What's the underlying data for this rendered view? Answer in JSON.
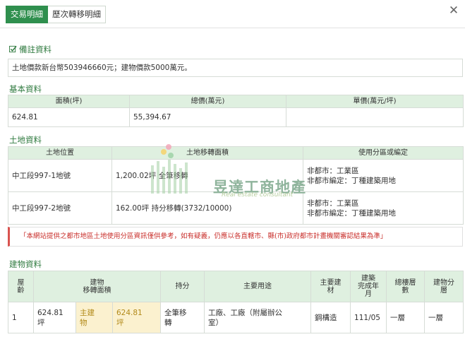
{
  "tabs": [
    {
      "label": "交易明細",
      "active": true
    },
    {
      "label": "歷次轉移明細",
      "active": false
    }
  ],
  "note_section": {
    "title": "備註資料",
    "text": "土地價款新台幣503946660元；建物價款5000萬元。"
  },
  "basic": {
    "title": "基本資料",
    "headers": [
      "面積(坪)",
      "總價(萬元)",
      "單價(萬元/坪)"
    ],
    "row": [
      "624.81",
      "55,394.67",
      ""
    ]
  },
  "land": {
    "title": "土地資料",
    "headers": [
      "土地位置",
      "土地移轉面積",
      "使用分區或編定"
    ],
    "rows": [
      {
        "location": "中工段997-1地號",
        "area": "1,200.02坪 全筆移轉",
        "zone_1": "非都市：工業區",
        "zone_2": "非都市編定：丁種建築用地"
      },
      {
        "location": "中工段997-2地號",
        "area": "162.00坪 持分移轉(3732/10000)",
        "zone_1": "非都市：工業區",
        "zone_2": "非都市編定：丁種建築用地"
      }
    ]
  },
  "warning": "「本網站提供之都市地區土地使用分區資訊僅供參考，如有疑義，仍應以各直轄市、縣(市)政府都市計畫機關審認結果為準」",
  "building": {
    "title": "建物資料",
    "headers": {
      "floor_age": [
        "屋",
        "齡"
      ],
      "transfer_area": [
        "建物",
        "移轉面積"
      ],
      "share": "持分",
      "main_use": "主要用途",
      "material": [
        "主要建",
        "材"
      ],
      "completion": [
        "建築",
        "完成年",
        "月"
      ],
      "total_floors": [
        "總樓層",
        "數"
      ],
      "floor": [
        "建物分",
        "層"
      ]
    },
    "row": {
      "age": "1",
      "area": [
        "624.81",
        "坪"
      ],
      "main_label": [
        "主建",
        "物"
      ],
      "main_area": [
        "624.81",
        "坪"
      ],
      "share": [
        "全筆移",
        "轉"
      ],
      "use": [
        "工廠、工廠（附屬辦公",
        "室）"
      ],
      "material": "鋼構造",
      "completion": "111/05",
      "total_floors": "一層",
      "floor": "一層"
    }
  },
  "watermark": {
    "name": "昱達工商地產",
    "sub": "Real estate consultant"
  },
  "colors": {
    "accent": "#2f8f4e",
    "header_bg": "#dff0e0",
    "warning": "#c9302c"
  }
}
